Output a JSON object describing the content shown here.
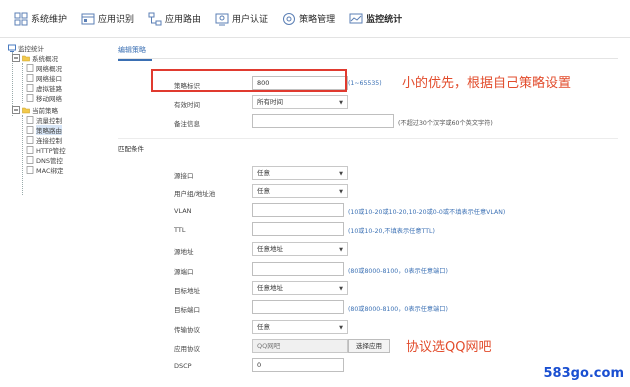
{
  "nav": {
    "items": [
      {
        "label": "系统维护",
        "icon": "grid-icon"
      },
      {
        "label": "应用识别",
        "icon": "apps-icon"
      },
      {
        "label": "应用路由",
        "icon": "route-icon"
      },
      {
        "label": "用户认证",
        "icon": "user-icon"
      },
      {
        "label": "策略管理",
        "icon": "policy-icon"
      },
      {
        "label": "监控统计",
        "icon": "monitor-icon"
      }
    ]
  },
  "sidebar": {
    "root": "监控统计",
    "groups": [
      {
        "label": "系统概况",
        "children": [
          "网络概况",
          "网络接口",
          "虚拟链路",
          "移动网络"
        ]
      },
      {
        "label": "当前策略",
        "children": [
          "流量控制",
          "策略路由",
          "连接控制",
          "HTTP管控",
          "DNS管控",
          "MAC绑定"
        ]
      }
    ],
    "selected": "策略路由"
  },
  "form": {
    "tab_label": "编辑策略",
    "section_match": "匹配条件",
    "priority": {
      "label": "策略标识",
      "value": "800",
      "hint": "(1~65535)"
    },
    "effective_time": {
      "label": "有效时间",
      "value": "所有时间"
    },
    "remark": {
      "label": "备注信息",
      "value": "",
      "hint": "(不超过30个汉字或60个英文字符)"
    },
    "source_port": {
      "label": "源接口",
      "value": "任意"
    },
    "user_group": {
      "label": "用户组/地址池",
      "value": "任意"
    },
    "vlan": {
      "label": "VLAN",
      "value": "",
      "hint": "(10或10-20或10-20,10-20或0-0或不填表示任意VLAN)"
    },
    "ttl": {
      "label": "TTL",
      "value": "",
      "hint": "(10或10-20,不填表示任意TTL)"
    },
    "src_addr": {
      "label": "源地址",
      "value": "任意地址"
    },
    "src_port": {
      "label": "源端口",
      "value": "",
      "hint": "(80或8000-8100，0表示任意端口)"
    },
    "dst_addr": {
      "label": "目标地址",
      "value": "任意地址"
    },
    "dst_port": {
      "label": "目标端口",
      "value": "",
      "hint": "(80或8000-8100，0表示任意端口)"
    },
    "protocol": {
      "label": "传输协议",
      "value": "任意"
    },
    "app_protocol": {
      "label": "应用协议",
      "value": "QQ网吧",
      "button": "选择应用"
    },
    "dscp": {
      "label": "DSCP",
      "value": "0"
    }
  },
  "annotations": {
    "priority_note": "小的优先，根据自己策略设置",
    "protocol_note": "协议选QQ网吧"
  },
  "watermark": "583go.com",
  "colors": {
    "accent": "#3a6fb3",
    "annotation": "#e24c2c",
    "highlight_box": "#e03a2f",
    "watermark": "#1a4fd1"
  }
}
